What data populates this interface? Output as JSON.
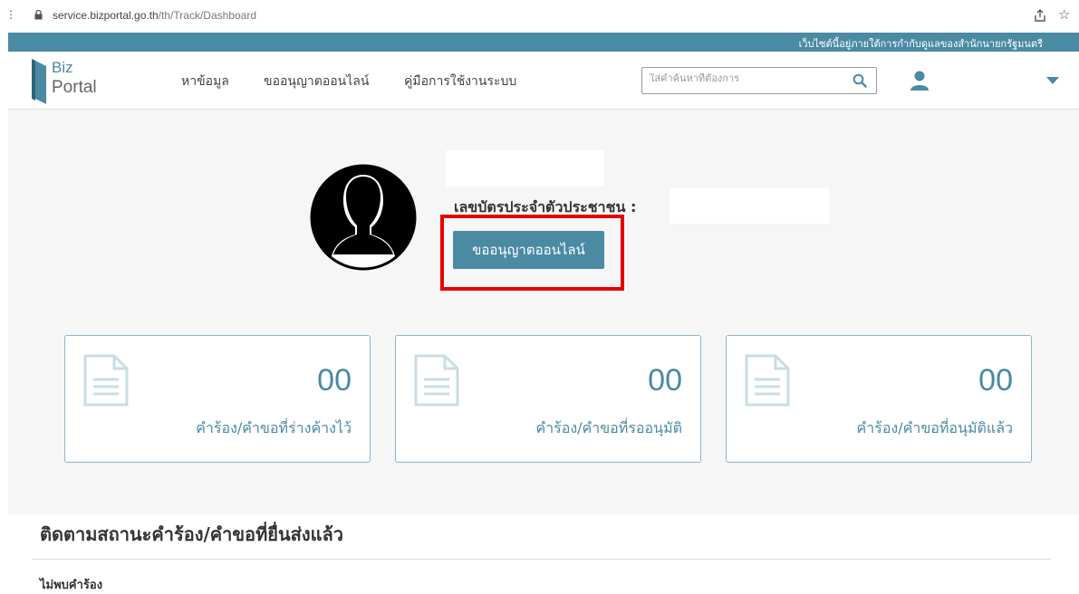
{
  "browser": {
    "url_host": "service.bizportal.go.th",
    "url_path": "/th/Track/Dashboard"
  },
  "gov_strip": {
    "text": "เว็บไซต์นี้อยู่ภายใต้การกำกับดูแลของสำนักนายกรัฐมนตรี"
  },
  "logo": {
    "line1": "Biz",
    "line2": "Portal"
  },
  "nav": {
    "items": [
      {
        "label": "หาข้อมูล"
      },
      {
        "label": "ขออนุญาตออนไลน์"
      },
      {
        "label": "คู่มือการใช้งานระบบ"
      }
    ],
    "search_placeholder": "ใส่คำค้นหาที่ต้องการ"
  },
  "profile": {
    "id_label": "เลขบัตรประจำตัวประชาชน :",
    "cta_label": "ขออนุญาตออนไลน์"
  },
  "cards": [
    {
      "count": "00",
      "label": "คำร้อง/คำขอที่ร่างค้างไว้"
    },
    {
      "count": "00",
      "label": "คำร้อง/คำขอที่รออนุมัติ"
    },
    {
      "count": "00",
      "label": "คำร้อง/คำขอที่อนุมัติแล้ว"
    }
  ],
  "tracking": {
    "title": "ติดตามสถานะคำร้อง/คำขอที่ยื่นส่งแล้ว",
    "empty_text": "ไม่พบคำร้อง"
  },
  "colors": {
    "brand": "#4a8aa3",
    "highlight": "#e60000",
    "panel_bg": "#f6f6f6"
  }
}
